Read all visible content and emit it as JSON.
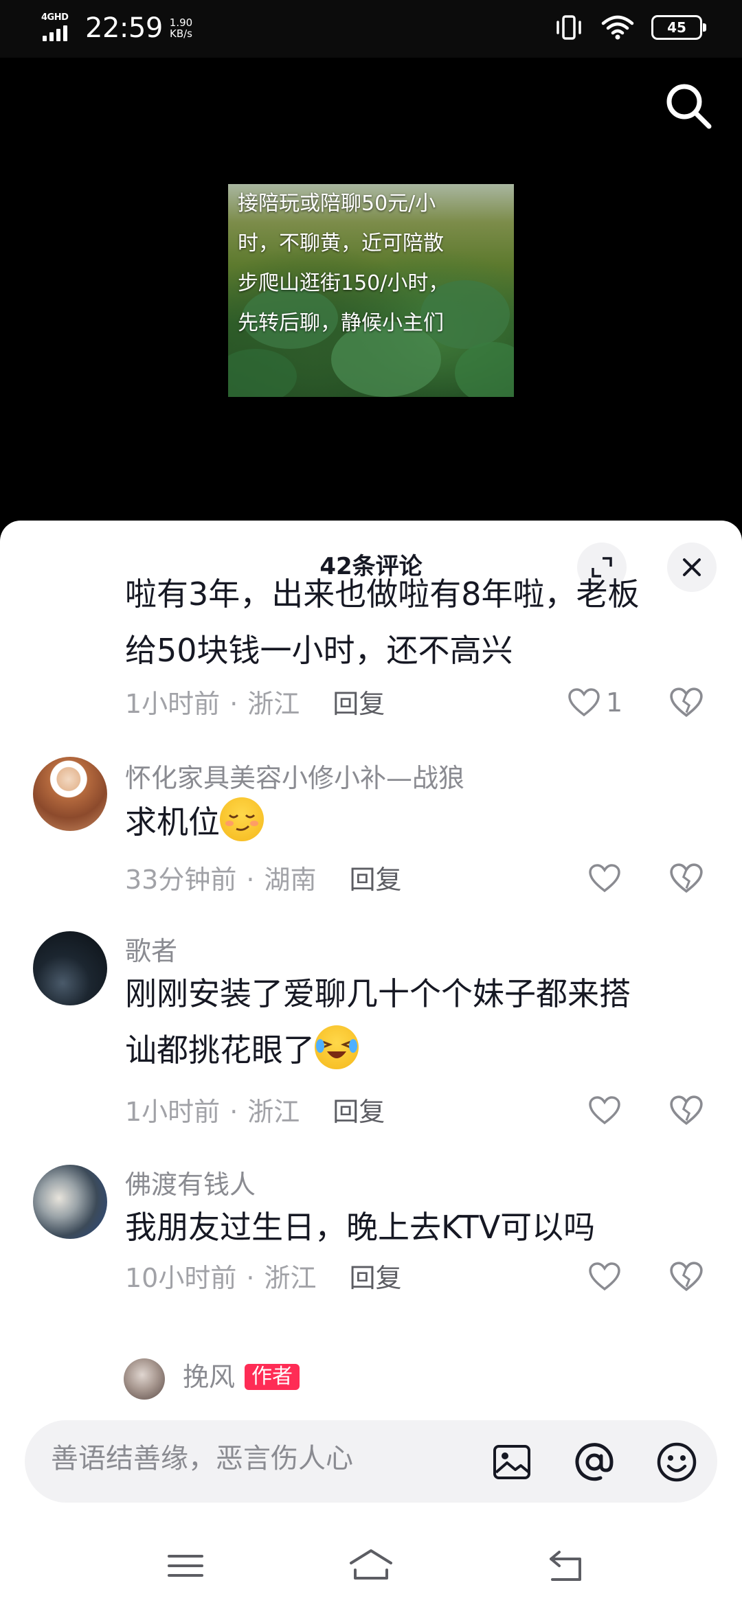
{
  "status_bar": {
    "network": "4GHD",
    "time": "22:59",
    "speed_value": "1.90",
    "speed_unit": "KB/s",
    "battery": "45"
  },
  "video": {
    "overlay_lines": [
      "接陪玩或陪聊50元/小",
      "时，不聊黄，近可陪散",
      "步爬山逛街150/小时，",
      "先转后聊，静候小主们"
    ],
    "search_icon": "search-icon"
  },
  "comments_panel": {
    "title": "42条评论",
    "expand_icon": "expand-icon",
    "close_icon": "close-icon",
    "comments": [
      {
        "text_lines": [
          "啦有3年，出来也做啦有8年啦，老板",
          "给50块钱一小时，还不高兴"
        ],
        "time": "1小时前",
        "location": "浙江",
        "reply": "回复",
        "likes": "1"
      },
      {
        "user": "怀化家具美容小修小补—战狼",
        "text": "求机位",
        "emoji": "smirk-emoji",
        "time": "33分钟前",
        "location": "湖南",
        "reply": "回复"
      },
      {
        "user": "歌者",
        "text_lines": [
          "刚刚安装了爱聊几十个个妹子都来搭",
          "讪都挑花眼了"
        ],
        "emoji": "laughing-crying-emoji",
        "time": "1小时前",
        "location": "浙江",
        "reply": "回复"
      },
      {
        "user": "佛渡有钱人",
        "text": "我朋友过生日，晚上去KTV可以吗",
        "time": "10小时前",
        "location": "浙江",
        "reply": "回复"
      },
      {
        "user": "挽风",
        "author_tag": "作者"
      }
    ]
  },
  "input_bar": {
    "placeholder": "善语结善缘，恶言伤人心",
    "icons": [
      "image-icon",
      "at-icon",
      "emoji-icon"
    ]
  },
  "nav_bar": {
    "icons": [
      "menu-icon",
      "home-icon",
      "back-icon"
    ]
  },
  "colors": {
    "accent": "#fe2c55",
    "panel_bg": "#ffffff",
    "muted_text": "#8a8b91"
  }
}
